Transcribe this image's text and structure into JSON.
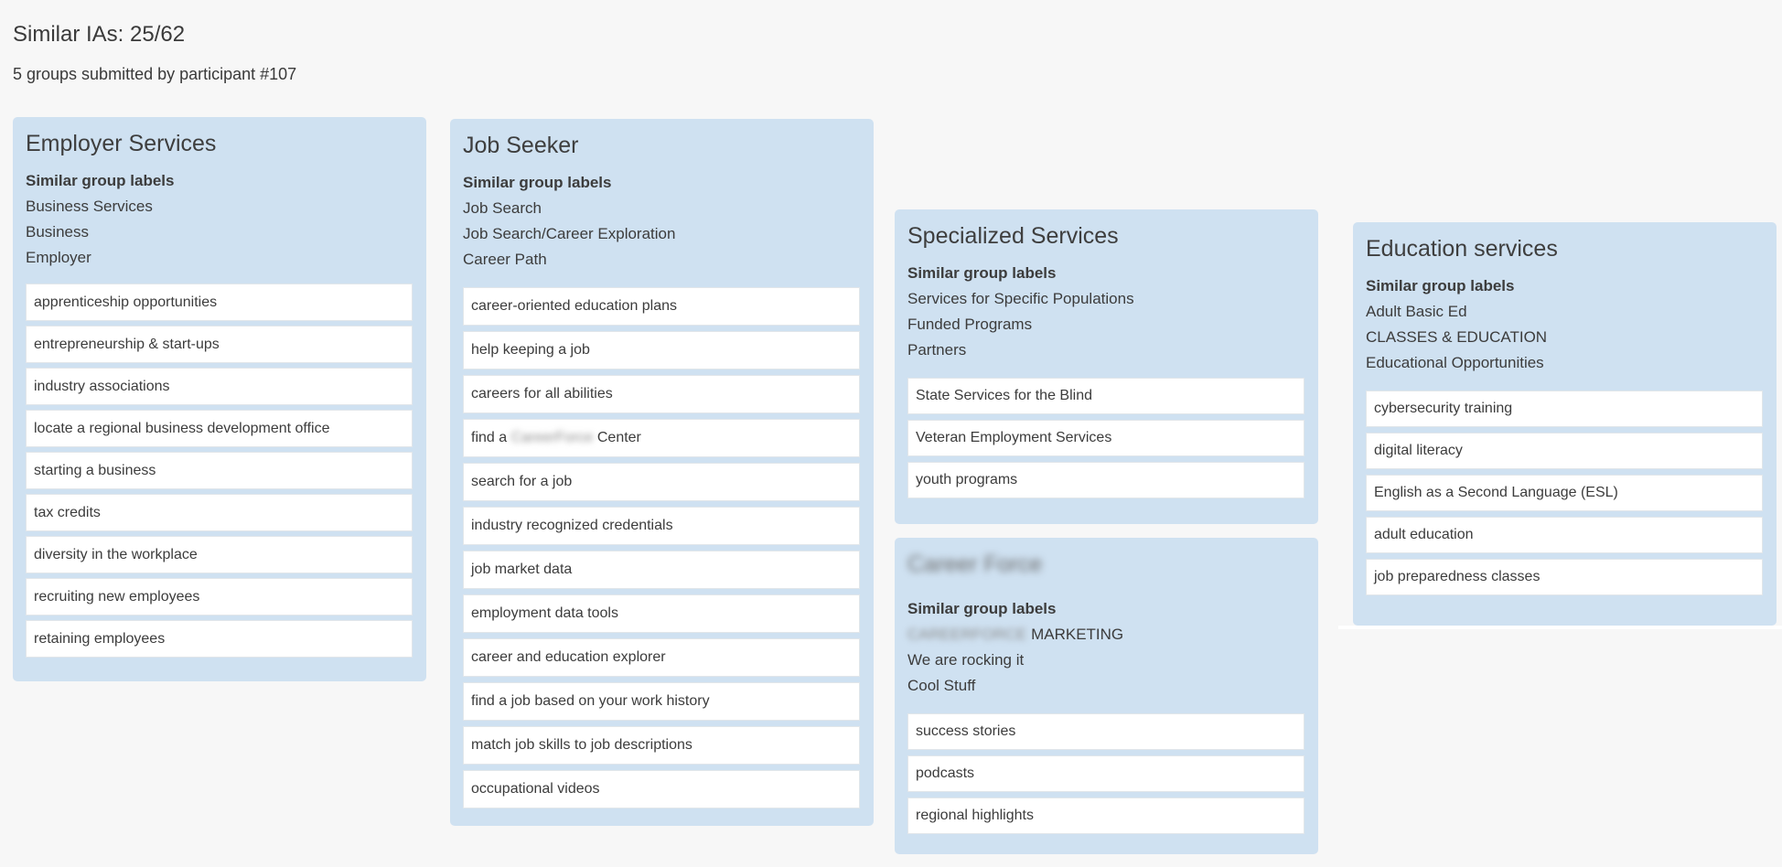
{
  "header": {
    "title": "Similar IAs: 25/62",
    "subtitle": "5 groups submitted by participant #107"
  },
  "similar_heading": "Similar group labels",
  "groups": [
    {
      "title": "Employer Services",
      "similar_labels": [
        "Business Services",
        "Business",
        "Employer"
      ],
      "items": [
        "apprenticeship opportunities",
        "entrepreneurship & start-ups",
        "industry associations",
        "locate a regional business development office",
        "starting a business",
        "tax credits",
        "diversity in the workplace",
        "recruiting new employees",
        "retaining employees"
      ]
    },
    {
      "title": "Job Seeker",
      "similar_labels": [
        "Job Search",
        "Job Search/Career Exploration",
        "Career Path"
      ],
      "items": [
        "career-oriented education plans",
        "help keeping a job",
        "careers for all abilities",
        {
          "prefix": "find a",
          "redacted": "CareerForce",
          "suffix": "Center"
        },
        "search for a job",
        "industry recognized credentials",
        "job market data",
        "employment data tools",
        "career and education explorer",
        "find a job based on your work history",
        "match job skills to job descriptions",
        "occupational videos"
      ]
    },
    {
      "title": "Specialized Services",
      "similar_labels": [
        "Services for Specific Populations",
        "Funded Programs",
        "Partners"
      ],
      "items": [
        "State Services for the Blind",
        "Veteran Employment Services",
        "youth programs"
      ]
    },
    {
      "title": "Career Force",
      "title_redacted": true,
      "similar_labels": [
        {
          "redacted": "CAREERFORCE",
          "suffix": "MARKETING"
        },
        "We are rocking it",
        "Cool Stuff"
      ],
      "items": [
        "success stories",
        "podcasts",
        "regional highlights"
      ]
    },
    {
      "title": "Education services",
      "similar_labels": [
        "Adult Basic Ed",
        "CLASSES & EDUCATION",
        "Educational Opportunities"
      ],
      "items": [
        "cybersecurity training",
        "digital literacy",
        "English as a Second Language (ESL)",
        "adult education",
        "job preparedness classes"
      ]
    }
  ],
  "colors": {
    "background": "#f7f7f7",
    "card": "#cfe1f1",
    "item": "#ffffff",
    "text": "#3c3c3c"
  }
}
